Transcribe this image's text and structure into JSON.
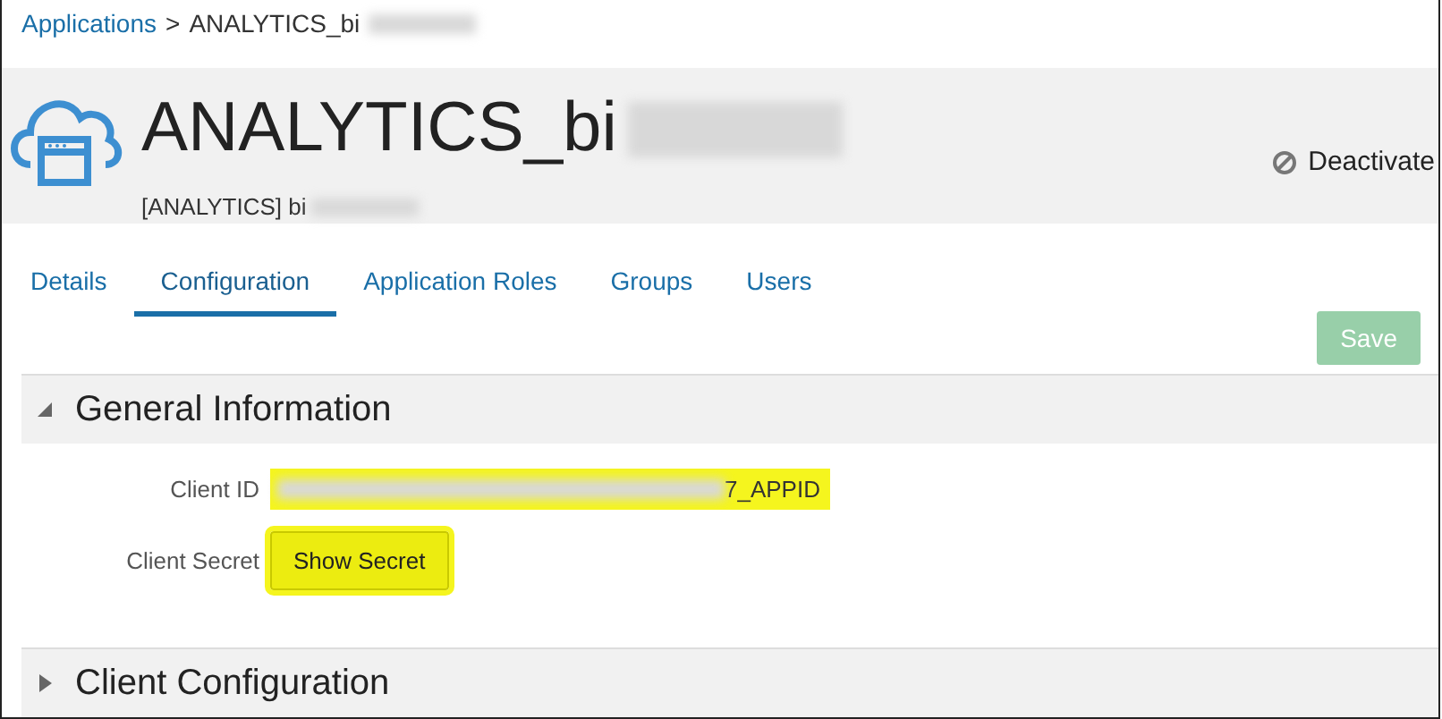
{
  "breadcrumb": {
    "link": "Applications",
    "separator": ">",
    "current": "ANALYTICS_bi"
  },
  "header": {
    "title": "ANALYTICS_bi",
    "subtitle": "[ANALYTICS] bi",
    "action": "Deactivate"
  },
  "tabs": [
    {
      "label": "Details",
      "selected": false
    },
    {
      "label": "Configuration",
      "selected": true
    },
    {
      "label": "Application Roles",
      "selected": false
    },
    {
      "label": "Groups",
      "selected": false
    },
    {
      "label": "Users",
      "selected": false
    }
  ],
  "save_button": {
    "label": "Save",
    "disabled": true
  },
  "sections": [
    {
      "title": "General Information",
      "expanded": true,
      "fields": [
        {
          "kind": "text",
          "label": "Client ID",
          "value": "7_APPID",
          "highlighted": true
        },
        {
          "kind": "button",
          "label": "Client Secret",
          "value": "Show Secret",
          "highlighted": true
        }
      ]
    },
    {
      "title": "Client Configuration",
      "expanded": false
    }
  ]
}
